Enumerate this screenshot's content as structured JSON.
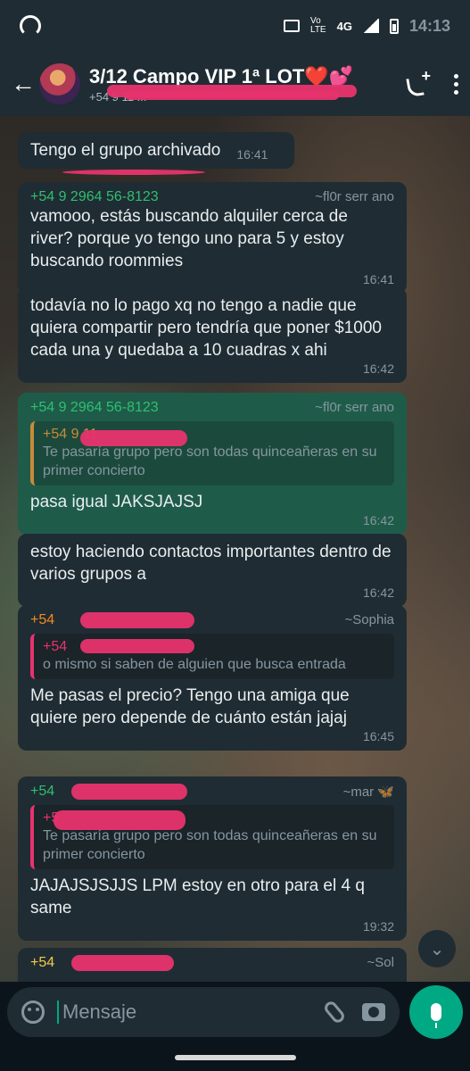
{
  "status_bar": {
    "network_top": "Vo",
    "network_bottom": "LTE",
    "network_type": "4G",
    "time": "14:13"
  },
  "header": {
    "title": "3/12 Campo VIP 1ª LOT❤️💕",
    "subtitle": "+54 9 11 ...",
    "back_icon": "arrow-left-icon",
    "call_icon": "add-call-icon",
    "menu_icon": "more-vert-icon"
  },
  "messages": [
    {
      "text": "Tengo el grupo archivado",
      "time": "16:41"
    },
    {
      "sender": "+54 9 2964 56-8123",
      "alias": "~fl0r serr ano",
      "text": "vamooo, estás buscando alquiler cerca de river? porque yo tengo uno para 5 y estoy buscando roommies",
      "time": "16:41"
    },
    {
      "text": "todavía no lo pago xq no tengo a nadie que quiera compartir pero tendría que poner $1000 cada una y quedaba a 10 cuadras x ahi",
      "time": "16:42"
    },
    {
      "sender": "+54 9 2964 56-8123",
      "alias": "~fl0r serr ano",
      "quote_sender": "+54 9 11",
      "quote_text": "Te pasaría grupo pero son todas quinceañeras en su primer concierto",
      "text": "pasa igual JAKSJAJSJ",
      "time": "16:42"
    },
    {
      "text": "estoy haciendo contactos importantes dentro de varios grupos a",
      "time": "16:42"
    },
    {
      "sender": "+54",
      "alias": "~Sophia",
      "quote_sender": "+54",
      "quote_text": "o mismo si saben de alguien que busca entrada",
      "text": "Me pasas el precio? Tengo una amiga que quiere pero depende de cuánto están jajaj",
      "time": "16:45"
    },
    {
      "sender": "+54",
      "alias": "~mar 🦋",
      "quote_sender": "+5",
      "quote_text": "Te pasaría grupo pero son todas quinceañeras en su primer concierto",
      "text": "JAJAJSJSJJS LPM estoy en otro para el 4 q same",
      "time": "19:32"
    },
    {
      "sender": "+54",
      "alias": "~Sol"
    }
  ],
  "input": {
    "placeholder": "Mensaje"
  },
  "colors": {
    "accent": "#00a884",
    "bubble": "#1f2c33",
    "sender_green": "#2fbf71",
    "sender_orange": "#f58a1f",
    "redaction": "#e8336e"
  }
}
